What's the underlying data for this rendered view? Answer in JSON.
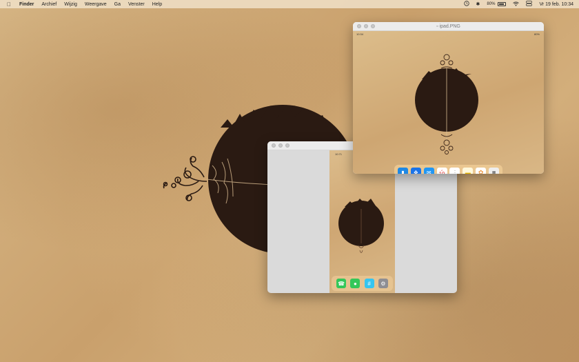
{
  "menubar": {
    "apple_icon": "apple-logo",
    "items": [
      "Finder",
      "Archief",
      "Wijzig",
      "Weergave",
      "Ga",
      "Venster",
      "Help"
    ],
    "battery_percent": "80%",
    "datetime": "Vr 19 feb.  10:34",
    "status_icons": [
      "clock-icon",
      "bluetooth-icon",
      "battery-icon",
      "wifi-icon",
      "control-center-icon"
    ]
  },
  "iphone_window": {
    "status_time": "10:71",
    "dock_apps": [
      "phone-icon",
      "messages-icon",
      "slack-icon",
      "settings-icon"
    ]
  },
  "ipad_window": {
    "title": "ipad.PNG",
    "status_left": "10:34",
    "status_right": "80%",
    "calendar_day": "19",
    "calendar_weekday": "vr",
    "dock_apps": [
      "files-icon",
      "safari-icon",
      "mail-icon",
      "calendar-icon",
      "reminders-icon",
      "notes-icon",
      "photos-icon",
      "app-library-icon"
    ]
  },
  "colors": {
    "wallpaper": "#cfa774",
    "art": "#2a1a12",
    "window_bg": "#dadada"
  }
}
